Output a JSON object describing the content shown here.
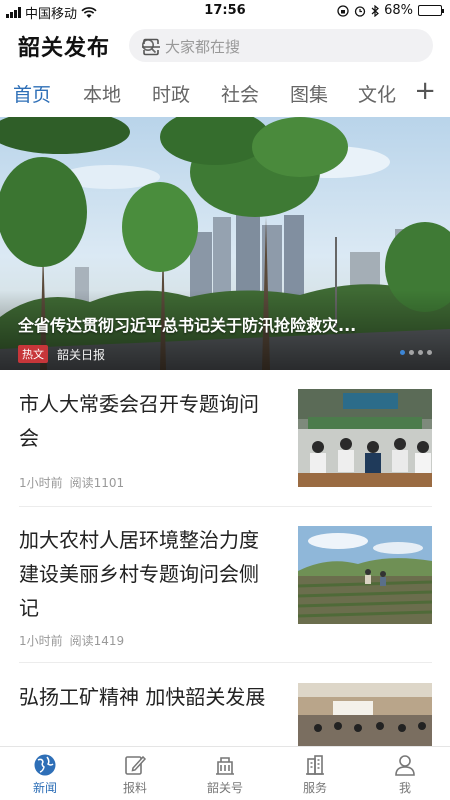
{
  "status_bar": {
    "carrier": "中国移动",
    "time": "17:56",
    "battery": "68%",
    "battery_level": 0.68
  },
  "header": {
    "title": "韶关发布",
    "search_placeholder": "大家都在搜",
    "search_icon": "search-icon",
    "scan_icon": "scan-icon"
  },
  "tabs": [
    "首页",
    "本地",
    "时政",
    "社会",
    "图集",
    "文化"
  ],
  "active_tab": "首页",
  "tab_more": "+",
  "hero": {
    "title": "全省传达贯彻习近平总书记关于防汛抢险救灾...",
    "badge": "热文",
    "source": "韶关日报",
    "slide_count": 4,
    "active_slide": 1
  },
  "news": [
    {
      "title": "市人大常委会召开专题询问会",
      "time": "1小时前",
      "reads": "阅读1101"
    },
    {
      "title": "加大农村人居环境整治力度建设美丽乡村专题询问会侧记",
      "time": "1小时前",
      "reads": "阅读1419"
    },
    {
      "title": "弘扬工矿精神 加快韶关发展",
      "time": "",
      "reads": ""
    }
  ],
  "bottom_nav": [
    {
      "label": "新闻",
      "icon": "globe-icon"
    },
    {
      "label": "报料",
      "icon": "edit-icon"
    },
    {
      "label": "韶关号",
      "icon": "building-icon"
    },
    {
      "label": "服务",
      "icon": "city-icon"
    },
    {
      "label": "我",
      "icon": "user-icon"
    }
  ],
  "colors": {
    "accent": "#2e6fb7",
    "hot_badge": "#c7363a",
    "meta_text": "#999999"
  }
}
